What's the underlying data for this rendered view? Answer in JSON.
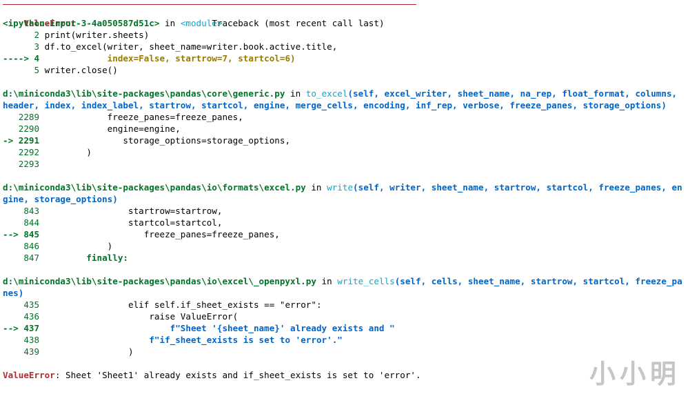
{
  "header": {
    "error_name": "ValueError",
    "traceback_title": "Traceback (most recent call last)"
  },
  "frames": [
    {
      "location": {
        "file": "<ipython-input-3-4a050587d51c>",
        "in_word": " in ",
        "func": "<module>",
        "sig": ""
      },
      "lines": [
        {
          "arrow": "      ",
          "num": "2",
          "code": " print(writer.sheets)"
        },
        {
          "arrow": "      ",
          "num": "3",
          "code": " df.to_excel(writer, sheet_name=writer.book.active.title,"
        },
        {
          "arrow": "----> ",
          "num": "4",
          "code": "             index=False, startrow=7, startcol=6)"
        },
        {
          "arrow": "      ",
          "num": "5",
          "code": " writer.close()"
        }
      ]
    },
    {
      "location": {
        "file": "d:\\miniconda3\\lib\\site-packages\\pandas\\core\\generic.py",
        "in_word": " in ",
        "func": "to_excel",
        "sig": "(self, excel_writer, sheet_name, na_rep, float_format, columns, header, index, index_label, startrow, startcol, engine, merge_cells, encoding, inf_rep, verbose, freeze_panes, storage_options)"
      },
      "lines": [
        {
          "arrow": "   ",
          "num": "2289",
          "code": "             freeze_panes=freeze_panes,"
        },
        {
          "arrow": "   ",
          "num": "2290",
          "code": "             engine=engine,"
        },
        {
          "arrow": "-> ",
          "num": "2291",
          "code": "                storage_options=storage_options,"
        },
        {
          "arrow": "   ",
          "num": "2292",
          "code": "         )"
        },
        {
          "arrow": "   ",
          "num": "2293",
          "code": ""
        }
      ]
    },
    {
      "location": {
        "file": "d:\\miniconda3\\lib\\site-packages\\pandas\\io\\formats\\excel.py",
        "in_word": " in ",
        "func": "write",
        "sig": "(self, writer, sheet_name, startrow, startcol, freeze_panes, engine, storage_options)"
      },
      "lines": [
        {
          "arrow": "    ",
          "num": "843",
          "code": "                 startrow=startrow,"
        },
        {
          "arrow": "    ",
          "num": "844",
          "code": "                 startcol=startcol,"
        },
        {
          "arrow": "--> ",
          "num": "845",
          "code": "                    freeze_panes=freeze_panes,"
        },
        {
          "arrow": "    ",
          "num": "846",
          "code": "             )"
        },
        {
          "arrow": "    ",
          "num": "847",
          "code": "         finally:"
        }
      ]
    },
    {
      "location": {
        "file": "d:\\miniconda3\\lib\\site-packages\\pandas\\io\\excel\\_openpyxl.py",
        "in_word": " in ",
        "func": "write_cells",
        "sig": "(self, cells, sheet_name, startrow, startcol, freeze_panes)"
      },
      "lines": [
        {
          "arrow": "    ",
          "num": "435",
          "code": "                 elif self.if_sheet_exists == \"error\":"
        },
        {
          "arrow": "    ",
          "num": "436",
          "code": "                     raise ValueError("
        },
        {
          "arrow": "--> ",
          "num": "437",
          "code": "                         f\"Sheet '{sheet_name}' already exists and \""
        },
        {
          "arrow": "    ",
          "num": "438",
          "code": "                     f\"if_sheet_exists is set to 'error'.\""
        },
        {
          "arrow": "    ",
          "num": "439",
          "code": "                 )"
        }
      ]
    }
  ],
  "footer": {
    "error_name": "ValueError",
    "message": ": Sheet 'Sheet1' already exists and if_sheet_exists is set to 'error'."
  },
  "watermark": "小小明"
}
